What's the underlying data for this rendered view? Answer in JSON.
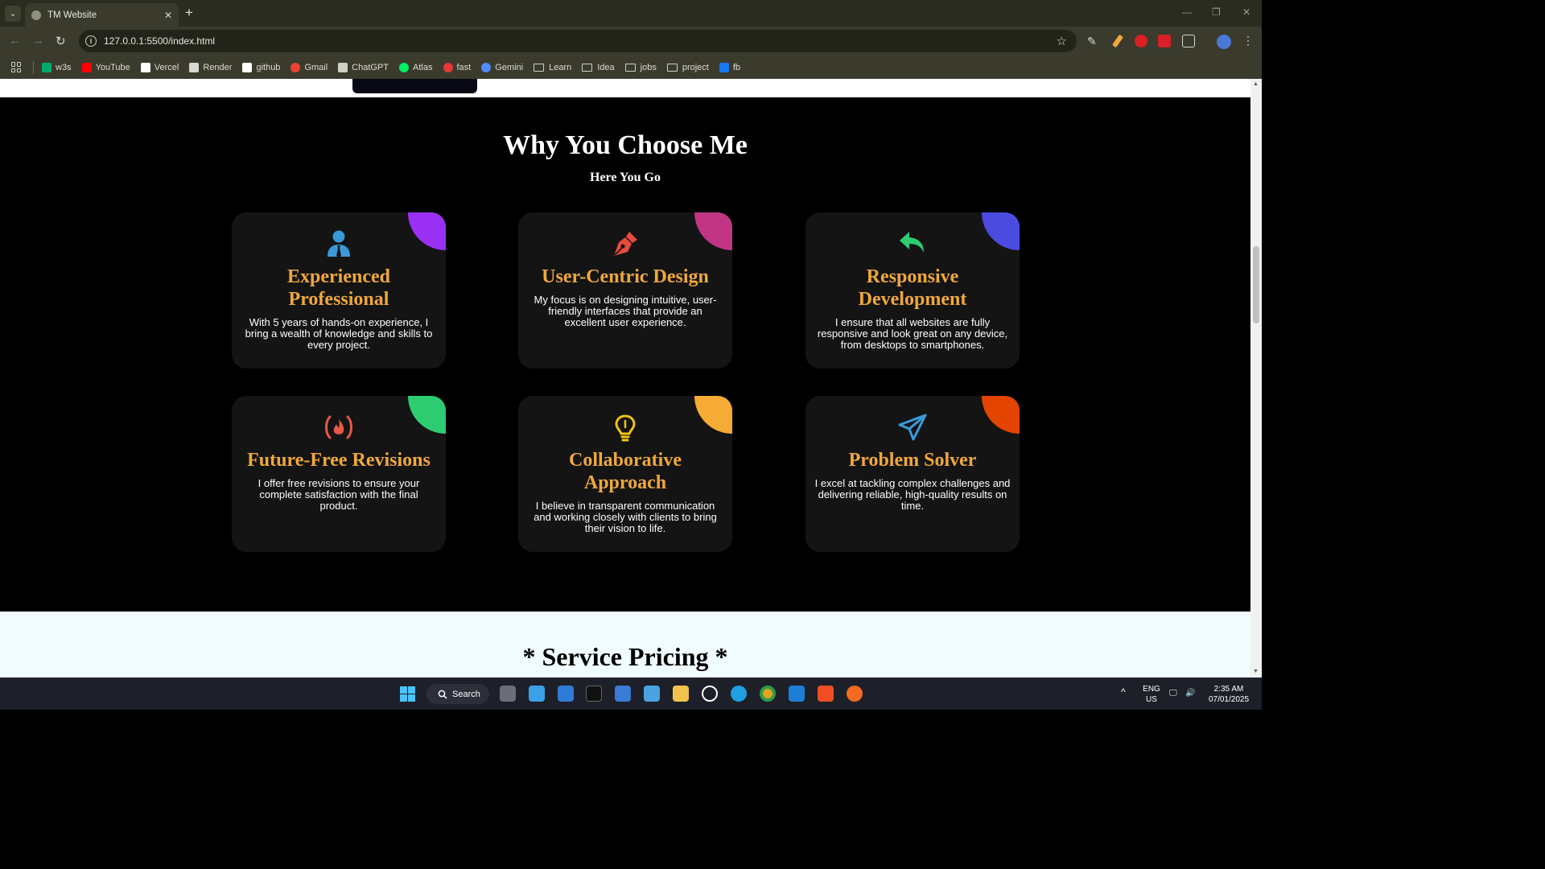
{
  "browser": {
    "tab_title": "TM Website",
    "tab_close": "✕",
    "new_tab": "+",
    "url": "127.0.0.1:5500/index.html",
    "bookmarks": [
      {
        "label": "w3s",
        "icon": "w3s-icon",
        "color": "#04aa6d"
      },
      {
        "label": "YouTube",
        "icon": "youtube-icon",
        "color": "#ff0000"
      },
      {
        "label": "Vercel",
        "icon": "vercel-icon",
        "color": "#ffffff"
      },
      {
        "label": "Render",
        "icon": "render-icon",
        "color": "#d8d8d0"
      },
      {
        "label": "github",
        "icon": "github-icon",
        "color": "#ffffff"
      },
      {
        "label": "Gmail",
        "icon": "gmail-icon",
        "color": "#ea4335"
      },
      {
        "label": "ChatGPT",
        "icon": "chatgpt-icon",
        "color": "#d0d0c8"
      },
      {
        "label": "Atlas",
        "icon": "atlas-icon",
        "color": "#00ed64"
      },
      {
        "label": "fast",
        "icon": "fast-icon",
        "color": "#e53935"
      },
      {
        "label": "Gemini",
        "icon": "gemini-icon",
        "color": "#4f8df7"
      },
      {
        "label": "Learn",
        "icon": "folder-icon",
        "color": ""
      },
      {
        "label": "Idea",
        "icon": "folder-icon",
        "color": ""
      },
      {
        "label": "jobs",
        "icon": "folder-icon",
        "color": ""
      },
      {
        "label": "project",
        "icon": "folder-icon",
        "color": ""
      },
      {
        "label": "fb",
        "icon": "facebook-icon",
        "color": "#1877f2"
      }
    ]
  },
  "section": {
    "title": "Why You Choose Me",
    "subtitle": "Here You Go",
    "cards": [
      {
        "title": "Experienced Professional",
        "desc": "With 5 years of hands-on experience, I bring a wealth of knowledge and skills to every project.",
        "icon": "user-tie-icon",
        "accent": "#9b30f5",
        "icon_color": "#3a9ad9"
      },
      {
        "title": "User-Centric Design",
        "desc": "My focus is on designing intuitive, user-friendly interfaces that provide an excellent user experience.",
        "icon": "pen-nib-icon",
        "accent": "#c13584",
        "icon_color": "#e74c3c"
      },
      {
        "title": "Responsive Development",
        "desc": "I ensure that all websites are fully responsive and look great on any device, from desktops to smartphones.",
        "icon": "reply-arrow-icon",
        "accent": "#4b4be0",
        "icon_color": "#2ecc71"
      },
      {
        "title": "Future-Free Revisions",
        "desc": "I offer free revisions to ensure your complete satisfaction with the final product.",
        "icon": "fire-code-icon",
        "accent": "#2ecc71",
        "icon_color": "#e8574a"
      },
      {
        "title": "Collaborative Approach",
        "desc": "I believe in transparent communication and working closely with clients to bring their vision to life.",
        "icon": "lightbulb-icon",
        "accent": "#f5ab35",
        "icon_color": "#f1c40f"
      },
      {
        "title": "Problem Solver",
        "desc": "I excel at tackling complex challenges and delivering reliable, high-quality results on time.",
        "icon": "paper-plane-icon",
        "accent": "#e34400",
        "icon_color": "#3a9ad9"
      }
    ]
  },
  "pricing": {
    "title": "* Service Pricing *"
  },
  "taskbar": {
    "search_label": "Search",
    "lang": "ENG",
    "region": "US",
    "time": "2:35 AM",
    "date": "07/01/2025"
  }
}
